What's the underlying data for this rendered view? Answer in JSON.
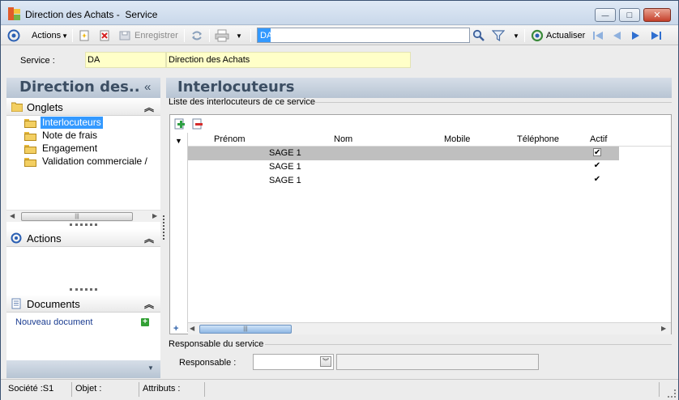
{
  "window": {
    "title": "Direction des Achats -  Service",
    "controls": {
      "minimize": "—",
      "maximize": "□",
      "close": "✕"
    }
  },
  "toolbar": {
    "actions_label": "Actions",
    "save_label": "Enregistrer",
    "search_value": "DA",
    "refresh_label": "Actualiser"
  },
  "service": {
    "label": "Service :",
    "code": "DA",
    "name": "Direction des Achats"
  },
  "left_pane": {
    "title": "Direction des..",
    "collapse_glyph": "«",
    "onglets": {
      "title": "Onglets",
      "items": [
        {
          "label": "Interlocuteurs",
          "selected": true
        },
        {
          "label": "Note de frais",
          "selected": false
        },
        {
          "label": "Engagement",
          "selected": false
        },
        {
          "label": "Validation commerciale /",
          "selected": false
        }
      ]
    },
    "actions_title": "Actions",
    "documents": {
      "title": "Documents",
      "new_document": "Nouveau document"
    }
  },
  "right_pane": {
    "title": "Interlocuteurs",
    "group_label": "Liste des interlocuteurs de ce service",
    "columns": [
      "Prénom",
      "Nom",
      "Mobile",
      "Téléphone",
      "Actif"
    ],
    "rows": [
      {
        "prenom": "",
        "nom": "SAGE 1",
        "mobile": "",
        "telephone": "",
        "actif": true
      },
      {
        "prenom": "",
        "nom": "SAGE 1",
        "mobile": "",
        "telephone": "",
        "actif": true
      },
      {
        "prenom": "",
        "nom": "SAGE 1",
        "mobile": "",
        "telephone": "",
        "actif": true
      }
    ],
    "responsable_group_label": "Responsable du service",
    "responsable_label": "Responsable :",
    "responsable_value": ""
  },
  "status_bar": {
    "societe": "Société :S1",
    "objet": "Objet :",
    "attributs": "Attributs :"
  },
  "colors": {
    "accent_blue": "#3399ff",
    "header_text": "#3c4e63",
    "field_yellow": "#ffffc8",
    "link_blue": "#1a3c91"
  }
}
